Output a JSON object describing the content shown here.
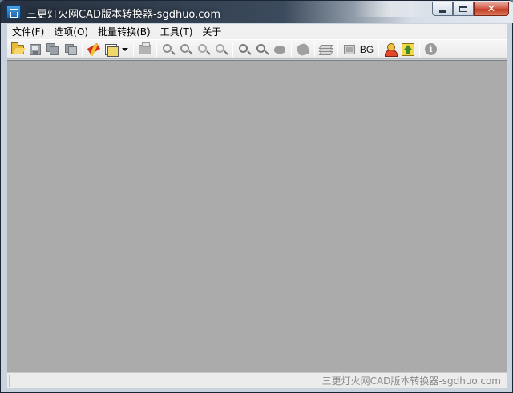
{
  "window": {
    "title": "三更灯火网CAD版本转换器-sgdhuo.com",
    "close_glyph": "✕"
  },
  "menu": {
    "items": [
      {
        "label": "文件(F)"
      },
      {
        "label": "选项(O)"
      },
      {
        "label": "批量转换(B)"
      },
      {
        "label": "工具(T)"
      },
      {
        "label": "关于"
      }
    ]
  },
  "toolbar": {
    "bg_label": "BG",
    "info_glyph": "i"
  },
  "statusbar": {
    "text": "三更灯火网CAD版本转换器-sgdhuo.com"
  },
  "colors": {
    "client_area": "#ababab",
    "menu_bg": "#f0f0f0",
    "close_button": "#c13c23"
  }
}
